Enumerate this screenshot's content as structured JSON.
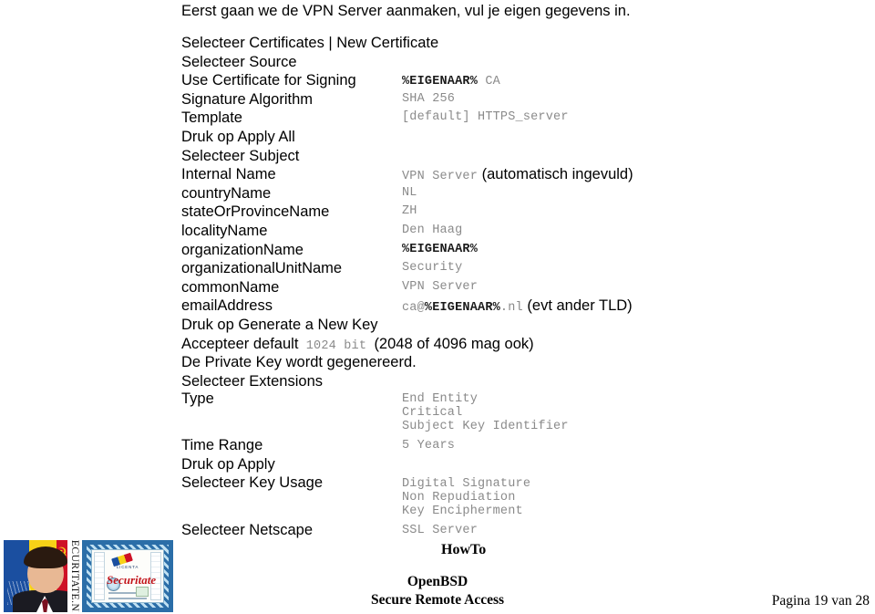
{
  "document": {
    "intro": "Eerst gaan we de VPN Server aanmaken, vul je eigen gegevens in."
  },
  "steps": [
    {
      "label": "Selecteer Certificates | New Certificate",
      "value": ""
    },
    {
      "label": "Selecteer Source",
      "value": ""
    },
    {
      "label": "Use Certificate for Signing",
      "value": "%EIGENAAR% CA"
    },
    {
      "label": "Signature Algorithm",
      "value": "SHA 256"
    },
    {
      "label": "Template",
      "value": "[default] HTTPS_server"
    },
    {
      "label": "Druk op Apply All",
      "value": ""
    },
    {
      "label": "Selecteer Subject",
      "value": ""
    },
    {
      "label": "Internal Name",
      "value": "VPN Server",
      "note": "(automatisch ingevuld)"
    },
    {
      "label": "countryName",
      "value": "NL"
    },
    {
      "label": "stateOrProvinceName",
      "value": "ZH"
    },
    {
      "label": "localityName",
      "value": "Den Haag"
    },
    {
      "label": "organizationName",
      "value": "%EIGENAAR%"
    },
    {
      "label": "organizationalUnitName",
      "value": "Security"
    },
    {
      "label": "commonName",
      "value": "VPN Server"
    },
    {
      "label": "emailAddress",
      "value_parts": [
        "ca@",
        "%EIGENAAR%",
        ".nl"
      ],
      "note": "(evt ander TLD)"
    },
    {
      "label": "Druk op Generate a New Key",
      "value": ""
    }
  ],
  "key_size_line": {
    "prefix": "Accepteer default",
    "mono": "1024 bit",
    "suffix": "(2048 of 4096 mag ook)"
  },
  "private_key_line": "De Private Key wordt gegenereerd.",
  "extensions": {
    "section_label": "Selecteer Extensions",
    "type_label": "Type",
    "type_values": [
      "End Entity",
      "Critical",
      "Subject Key Identifier"
    ],
    "time_range_label": "Time Range",
    "time_range_value": "5 Years",
    "apply_label": "Druk op Apply",
    "key_usage_label": "Selecteer Key Usage",
    "key_usage_values": [
      "Digital Signature",
      "Non Repudiation",
      "Key Encipherment"
    ],
    "netscape_label": "Selecteer Netscape",
    "netscape_value": "SSL Server"
  },
  "footer": {
    "howto": "HowTo",
    "title_line1": "OpenBSD",
    "title_line2": "Secure Remote Access",
    "page": "Pagina 19 van 28"
  },
  "banner": {
    "vertical_text": "SECURITATE.NL",
    "certificate_title": "Securitate",
    "certificate_subtitle": "LICENTA"
  },
  "colors": {
    "mono_value": "#8a8a8a",
    "emphasis": "#1a1a1a",
    "cert_red": "#c3161c",
    "cert_blue": "#2b6ea8"
  }
}
